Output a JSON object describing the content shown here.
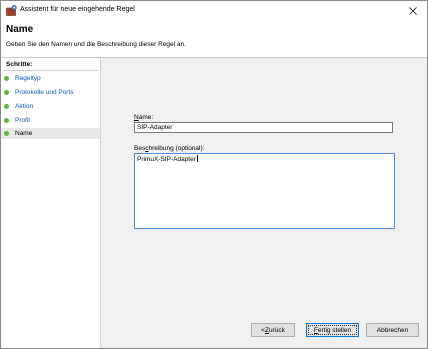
{
  "window": {
    "title": "Assistent für neue eingehende Regel"
  },
  "header": {
    "title": "Name",
    "description": "Geben Sie den Namen und die Beschreibung dieser Regel an."
  },
  "steps": {
    "heading": "Schritte:",
    "items": [
      {
        "label": "Regeltyp",
        "active": false
      },
      {
        "label": "Protokolle und Ports",
        "active": false
      },
      {
        "label": "Aktion",
        "active": false
      },
      {
        "label": "Profil",
        "active": false
      },
      {
        "label": "Name",
        "active": true
      }
    ],
    "dot_color": "#5cb83a"
  },
  "form": {
    "name_label_mnemonic": "N",
    "name_label_rest": "ame:",
    "name_value": "SIP-Adapter",
    "desc_label_pre": "Bes",
    "desc_label_mnemonic": "c",
    "desc_label_rest": "hreibung (optional):",
    "desc_value": "PrimuX-SIP-Adapter"
  },
  "buttons": {
    "back_pre": "< ",
    "back_mnemonic": "Z",
    "back_rest": "urück",
    "finish_mnemonic": "F",
    "finish_rest": "ertig stellen",
    "cancel": "Abbrechen"
  },
  "icons": {
    "app": "firewall-rule-icon",
    "close": "close-icon"
  }
}
